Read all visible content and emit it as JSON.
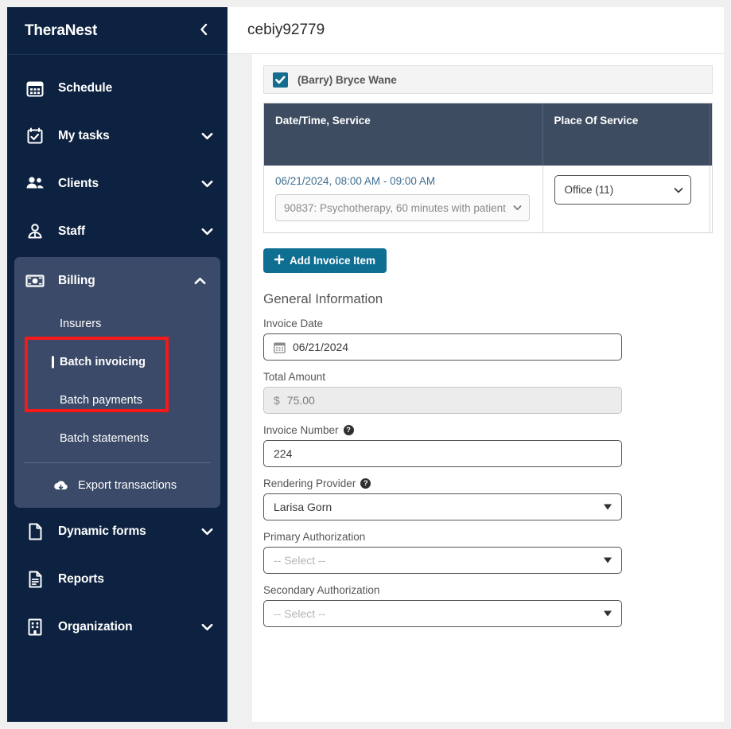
{
  "sidebar": {
    "brand": "TheraNest",
    "collapse_icon": "chevron-left-icon",
    "items": [
      {
        "label": "Schedule",
        "icon": "calendar-icon",
        "expandable": false
      },
      {
        "label": "My tasks",
        "icon": "task-calendar-icon",
        "expandable": true
      },
      {
        "label": "Clients",
        "icon": "clients-icon",
        "expandable": true
      },
      {
        "label": "Staff",
        "icon": "staff-icon",
        "expandable": true
      }
    ],
    "billing": {
      "label": "Billing",
      "icon": "money-icon",
      "expanded": true,
      "sub_items": [
        {
          "label": "Insurers",
          "active": false
        },
        {
          "label": "Batch invoicing",
          "active": true
        },
        {
          "label": "Batch payments",
          "active": false
        },
        {
          "label": "Batch statements",
          "active": false
        }
      ],
      "export": {
        "label": "Export transactions",
        "icon": "cloud-download-icon"
      }
    },
    "items_after": [
      {
        "label": "Dynamic forms",
        "icon": "document-icon",
        "expandable": true
      },
      {
        "label": "Reports",
        "icon": "report-icon",
        "expandable": false
      },
      {
        "label": "Organization",
        "icon": "building-icon",
        "expandable": true
      }
    ],
    "highlight_color": "#f41a1a",
    "background_color": "#0d2240",
    "group_background_color": "#3b4a68"
  },
  "header": {
    "title": "cebiy92779"
  },
  "client_row": {
    "name": "(Barry) Bryce Wane",
    "checked": true
  },
  "service_table": {
    "columns": [
      "Date/Time, Service",
      "Place Of Service",
      ""
    ],
    "rows": [
      {
        "datetime": "06/21/2024, 08:00 AM - 09:00 AM",
        "service": "90837: Psychotherapy, 60 minutes with patient",
        "place_of_service": "Office (11)"
      }
    ]
  },
  "actions": {
    "add_invoice_item": "Add Invoice Item",
    "plus_icon": "plus-icon"
  },
  "general_information": {
    "section_title": "General Information",
    "fields": [
      {
        "label": "Invoice Date",
        "value": "06/21/2024",
        "icon": "calendar-icon",
        "type": "date",
        "help": false
      },
      {
        "label": "Total Amount",
        "value": "75.00",
        "prefix": "$",
        "type": "readonly",
        "help": false
      },
      {
        "label": "Invoice Number",
        "value": "224",
        "type": "text",
        "help": true
      },
      {
        "label": "Rendering Provider",
        "value": "Larisa Gorn",
        "type": "select",
        "help": true
      },
      {
        "label": "Primary Authorization",
        "value": "-- Select --",
        "type": "select",
        "help": false,
        "placeholder": true
      },
      {
        "label": "Secondary Authorization",
        "value": "-- Select --",
        "type": "select",
        "help": false,
        "placeholder": true
      }
    ]
  },
  "colors": {
    "accent": "#0f6f93",
    "sidebar": "#0d2240",
    "table_header": "#3e4c61",
    "link": "#3d6e8f"
  }
}
